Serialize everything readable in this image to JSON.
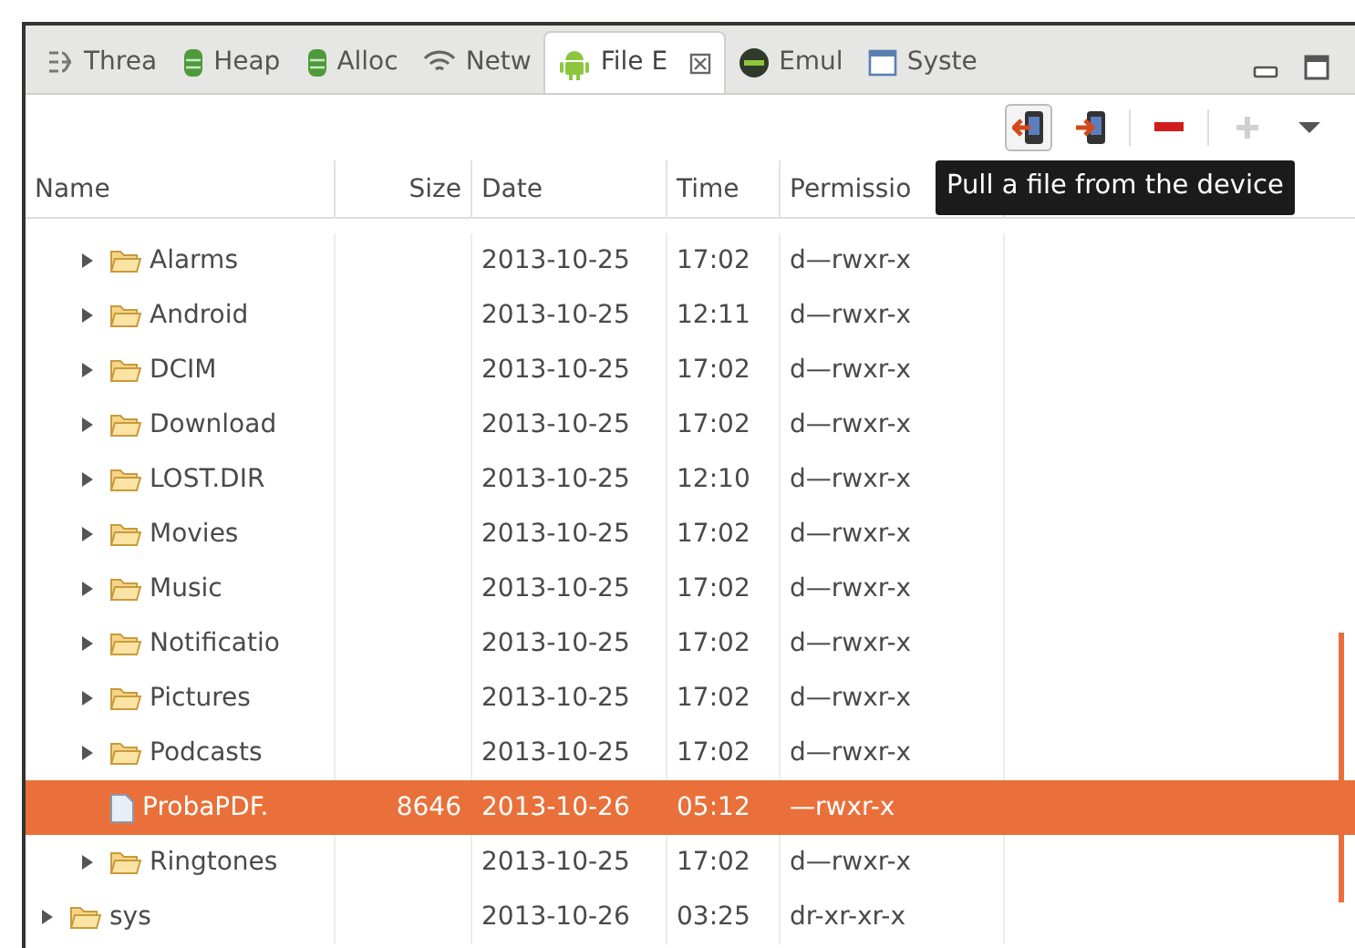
{
  "tabs": [
    {
      "label": "Threa",
      "selected": false
    },
    {
      "label": "Heap",
      "selected": false
    },
    {
      "label": "Alloc",
      "selected": false
    },
    {
      "label": "Netw",
      "selected": false
    },
    {
      "label": "File E",
      "selected": true
    },
    {
      "label": "Emul",
      "selected": false
    },
    {
      "label": "Syste",
      "selected": false
    }
  ],
  "toolbar": [
    {
      "kind": "pull",
      "disabled": false
    },
    {
      "kind": "push",
      "disabled": false
    },
    {
      "kind": "delete",
      "disabled": false
    },
    {
      "kind": "add",
      "disabled": true
    },
    {
      "kind": "menu",
      "disabled": false
    }
  ],
  "tooltip": "Pull a file from the device",
  "table": {
    "columns": [
      "Name",
      "Size",
      "Date",
      "Time",
      "Permissio"
    ],
    "tree": [
      {
        "children": [
          {
            "name": "Alarms",
            "kind": "folder",
            "date": "2013-10-25",
            "time": "17:02",
            "permissions": "d—rwxr-x",
            "selected": false
          },
          {
            "name": "Android",
            "kind": "folder",
            "date": "2013-10-25",
            "time": "12:11",
            "permissions": "d—rwxr-x",
            "selected": false
          },
          {
            "name": "DCIM",
            "kind": "folder",
            "date": "2013-10-25",
            "time": "17:02",
            "permissions": "d—rwxr-x",
            "selected": false
          },
          {
            "name": "Download",
            "kind": "folder",
            "date": "2013-10-25",
            "time": "17:02",
            "permissions": "d—rwxr-x",
            "selected": false
          },
          {
            "name": "LOST.DIR",
            "kind": "folder",
            "date": "2013-10-25",
            "time": "12:10",
            "permissions": "d—rwxr-x",
            "selected": false
          },
          {
            "name": "Movies",
            "kind": "folder",
            "date": "2013-10-25",
            "time": "17:02",
            "permissions": "d—rwxr-x",
            "selected": false
          },
          {
            "name": "Music",
            "kind": "folder",
            "date": "2013-10-25",
            "time": "17:02",
            "permissions": "d—rwxr-x",
            "selected": false
          },
          {
            "name": "Notificatio",
            "kind": "folder",
            "date": "2013-10-25",
            "time": "17:02",
            "permissions": "d—rwxr-x",
            "selected": false
          },
          {
            "name": "Pictures",
            "kind": "folder",
            "date": "2013-10-25",
            "time": "17:02",
            "permissions": "d—rwxr-x",
            "selected": false
          },
          {
            "name": "Podcasts",
            "kind": "folder",
            "date": "2013-10-25",
            "time": "17:02",
            "permissions": "d—rwxr-x",
            "selected": false
          },
          {
            "name": "ProbaPDF.",
            "kind": "file",
            "size": "8646",
            "date": "2013-10-26",
            "time": "05:12",
            "permissions": "—rwxr-x",
            "selected": true
          },
          {
            "name": "Ringtones",
            "kind": "folder",
            "date": "2013-10-25",
            "time": "17:02",
            "permissions": "d—rwxr-x",
            "selected": false
          }
        ]
      },
      {
        "name": "sys",
        "kind": "folder",
        "date": "2013-10-26",
        "time": "03:25",
        "permissions": "dr-xr-xr-x",
        "selected": false
      }
    ]
  }
}
